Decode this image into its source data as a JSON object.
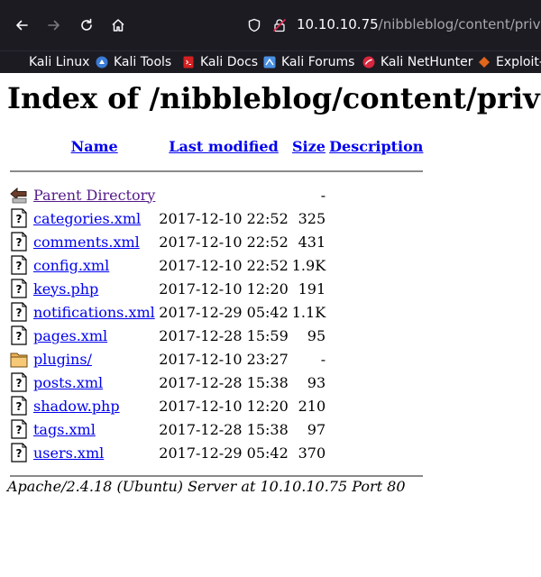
{
  "browser": {
    "url_host": "10.10.10.75",
    "url_path": "/nibbleblog/content/private/",
    "bookmarks": [
      {
        "label": "Kali Linux",
        "icon": "kali-linux-icon",
        "color": "#1c1b22"
      },
      {
        "label": "Kali Tools",
        "icon": "kali-tools-icon",
        "color": "#3a7bd5"
      },
      {
        "label": "Kali Docs",
        "icon": "kali-docs-icon",
        "color": "#d42020"
      },
      {
        "label": "Kali Forums",
        "icon": "kali-forums-icon",
        "color": "#4a90e2"
      },
      {
        "label": "Kali NetHunter",
        "icon": "kali-nethunter-icon",
        "color": "#d8263c"
      },
      {
        "label": "Exploit-",
        "icon": "exploit-db-icon",
        "color": "#e2651c"
      }
    ]
  },
  "page": {
    "title": "Index of /nibbleblog/content/private/",
    "columns": {
      "name": "Name",
      "last_modified": "Last modified",
      "size": "Size",
      "description": "Description"
    },
    "parent": {
      "name": "Parent Directory",
      "modified": "",
      "size": "-"
    },
    "rows": [
      {
        "name": "categories.xml",
        "modified": "2017-12-10 22:52",
        "size": "325",
        "icon": "unknown-file-icon"
      },
      {
        "name": "comments.xml",
        "modified": "2017-12-10 22:52",
        "size": "431",
        "icon": "unknown-file-icon"
      },
      {
        "name": "config.xml",
        "modified": "2017-12-10 22:52",
        "size": "1.9K",
        "icon": "unknown-file-icon"
      },
      {
        "name": "keys.php",
        "modified": "2017-12-10 12:20",
        "size": "191",
        "icon": "unknown-file-icon"
      },
      {
        "name": "notifications.xml",
        "modified": "2017-12-29 05:42",
        "size": "1.1K",
        "icon": "unknown-file-icon"
      },
      {
        "name": "pages.xml",
        "modified": "2017-12-28 15:59",
        "size": "95",
        "icon": "unknown-file-icon"
      },
      {
        "name": "plugins/",
        "modified": "2017-12-10 23:27",
        "size": "-",
        "icon": "folder-icon"
      },
      {
        "name": "posts.xml",
        "modified": "2017-12-28 15:38",
        "size": "93",
        "icon": "unknown-file-icon"
      },
      {
        "name": "shadow.php",
        "modified": "2017-12-10 12:20",
        "size": "210",
        "icon": "unknown-file-icon"
      },
      {
        "name": "tags.xml",
        "modified": "2017-12-28 15:38",
        "size": "97",
        "icon": "unknown-file-icon"
      },
      {
        "name": "users.xml",
        "modified": "2017-12-29 05:42",
        "size": "370",
        "icon": "unknown-file-icon"
      }
    ],
    "footer": "Apache/2.4.18 (Ubuntu) Server at 10.10.10.75 Port 80"
  },
  "colors": {
    "chrome_bg": "#1c1b22",
    "link": "#0000ee",
    "visited_link": "#551a8b"
  }
}
